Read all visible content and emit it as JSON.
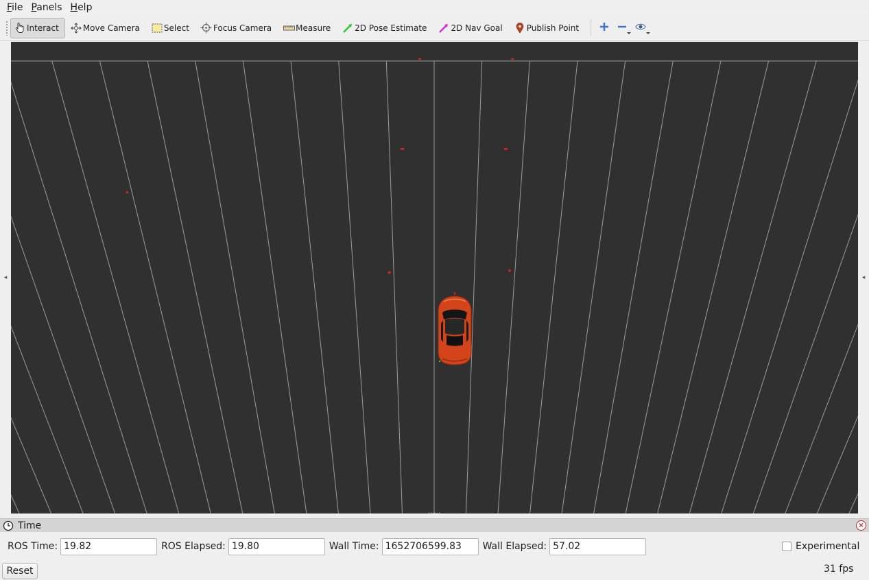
{
  "menubar": {
    "items": [
      {
        "first": "F",
        "rest": "ile"
      },
      {
        "first": "P",
        "rest": "anels"
      },
      {
        "first": "H",
        "rest": "elp"
      }
    ]
  },
  "toolbar": {
    "interact": "Interact",
    "move_camera": "Move Camera",
    "select": "Select",
    "focus_camera": "Focus Camera",
    "measure": "Measure",
    "pose_estimate": "2D Pose Estimate",
    "nav_goal": "2D Nav Goal",
    "publish_point": "Publish Point",
    "active_tool": "Interact"
  },
  "viewport": {
    "background": "#303030",
    "grid_color": "#a0a0a0",
    "marker_color": "#e02020",
    "car_color": "#d4441a"
  },
  "time_panel": {
    "title": "Time",
    "ros_time_label": "ROS Time:",
    "ros_time_value": "19.82",
    "ros_elapsed_label": "ROS Elapsed:",
    "ros_elapsed_value": "19.80",
    "wall_time_label": "Wall Time:",
    "wall_time_value": "1652706599.83",
    "wall_elapsed_label": "Wall Elapsed:",
    "wall_elapsed_value": "57.02",
    "experimental_label": "Experimental",
    "experimental_checked": false
  },
  "footer": {
    "reset_label": "Reset",
    "fps": "31 fps"
  }
}
